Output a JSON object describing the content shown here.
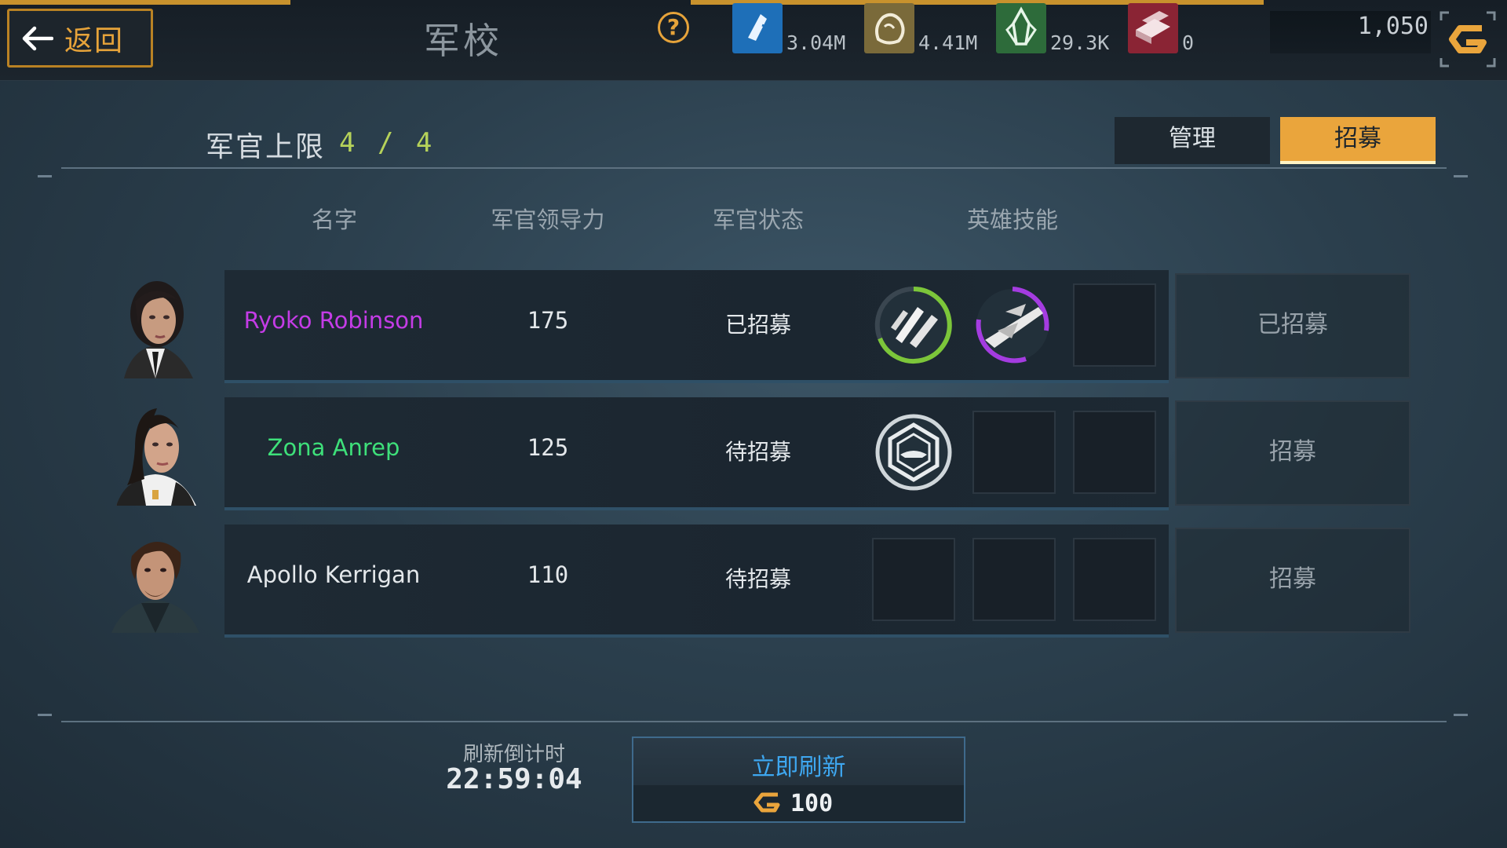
{
  "header": {
    "back_label": "返回",
    "title": "军校",
    "help_glyph": "?",
    "resources": [
      {
        "icon": "energy-cell-icon",
        "value": "3.04M",
        "color": "#1e6fb8"
      },
      {
        "icon": "ore-rock-icon",
        "value": "4.41M",
        "color": "#7a6a3a"
      },
      {
        "icon": "crystal-icon",
        "value": "29.3K",
        "color": "#2d6b3a"
      },
      {
        "icon": "alloy-bars-icon",
        "value": "0",
        "color": "#8a2434"
      }
    ],
    "gold": {
      "value": "1,050",
      "icon": "gold-currency-icon",
      "color": "#eaa53c"
    }
  },
  "officer_limit": {
    "label": "军官上限",
    "value": "4 / 4"
  },
  "tabs": [
    {
      "label": "管理",
      "active": false
    },
    {
      "label": "招募",
      "active": true
    }
  ],
  "columns": [
    "名字",
    "军官领导力",
    "军官状态",
    "英雄技能"
  ],
  "officers": [
    {
      "name": "Ryoko Robinson",
      "name_color": "#c43ce6",
      "leadership": "175",
      "status": "已招募",
      "skills": [
        "missile-barrage-skill-icon",
        "fighter-squadron-skill-icon",
        ""
      ],
      "action": "已招募"
    },
    {
      "name": "Zona Anrep",
      "name_color": "#3ee07a",
      "leadership": "125",
      "status": "待招募",
      "skills": [
        "ship-shield-skill-icon",
        "",
        ""
      ],
      "action": "招募"
    },
    {
      "name": "Apollo Kerrigan",
      "name_color": "#e4e8eb",
      "leadership": "110",
      "status": "待招募",
      "skills": [
        "",
        "",
        ""
      ],
      "action": "招募"
    }
  ],
  "footer": {
    "timer_label": "刷新倒计时",
    "timer_value": "22:59:04",
    "refresh_label": "立即刷新",
    "refresh_cost": "100"
  }
}
